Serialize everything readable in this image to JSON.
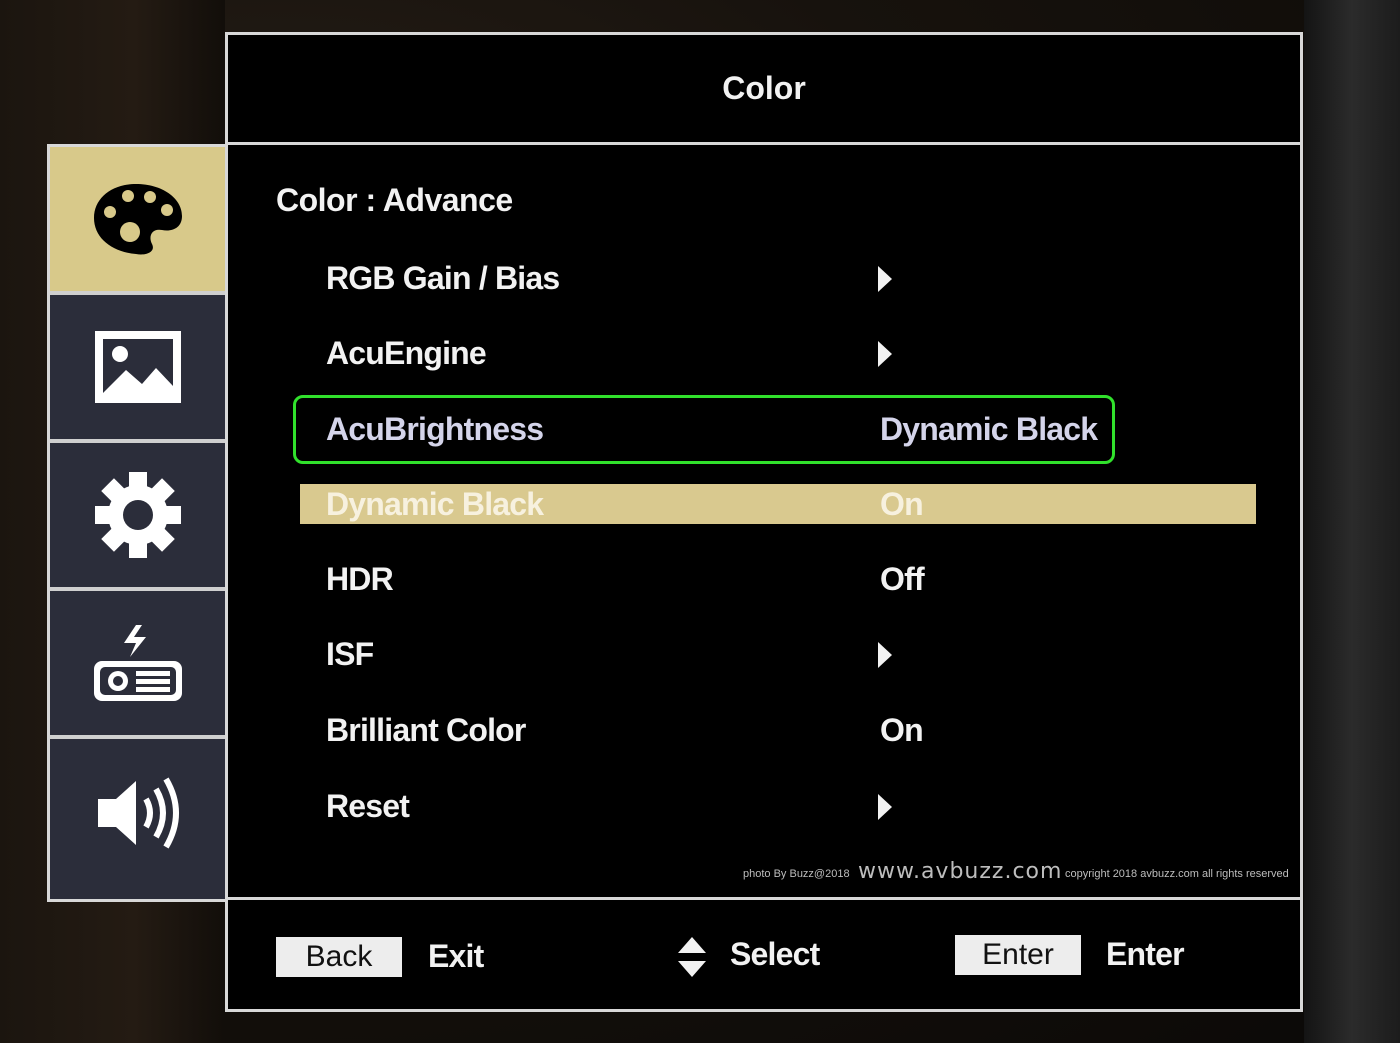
{
  "window": {
    "title": "Color"
  },
  "breadcrumb": "Color : Advance",
  "sidebar": {
    "items": [
      {
        "icon": "palette-icon",
        "active": true
      },
      {
        "icon": "image-icon",
        "active": false
      },
      {
        "icon": "gear-icon",
        "active": false
      },
      {
        "icon": "projector-icon",
        "active": false
      },
      {
        "icon": "speaker-icon",
        "active": false
      }
    ]
  },
  "menu": {
    "items": [
      {
        "label": "RGB Gain / Bias",
        "value": "",
        "submenu": true
      },
      {
        "label": "AcuEngine",
        "value": "",
        "submenu": true
      },
      {
        "label": "AcuBrightness",
        "value": "Dynamic Black",
        "submenu": false
      },
      {
        "label": "Dynamic Black",
        "value": "On",
        "submenu": false
      },
      {
        "label": "HDR",
        "value": "Off",
        "submenu": false
      },
      {
        "label": "ISF",
        "value": "",
        "submenu": true
      },
      {
        "label": "Brilliant Color",
        "value": "On",
        "submenu": false
      },
      {
        "label": "Reset",
        "value": "",
        "submenu": true
      }
    ],
    "selected_index": 3,
    "annotated_index": 2
  },
  "watermark": {
    "photo_by": "photo By Buzz@2018",
    "site": "www.avbuzz.com",
    "copyright": "copyright 2018 avbuzz.com all rights reserved"
  },
  "footer": {
    "back_key": "Back",
    "back_action": "Exit",
    "select_action": "Select",
    "enter_key": "Enter",
    "enter_action": "Enter"
  },
  "colors": {
    "highlight": "#d9c98f",
    "sidebar_active": "#d8c98a",
    "sidebar_bg": "#2b2d3a",
    "annotation": "#31e12c"
  }
}
